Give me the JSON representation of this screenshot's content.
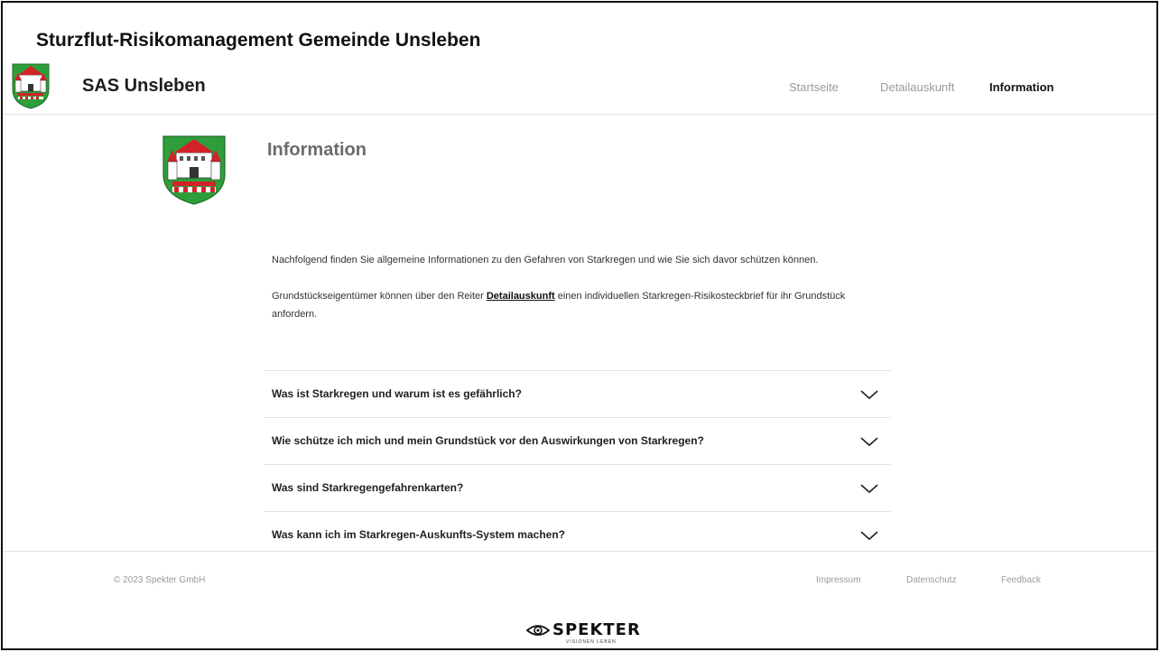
{
  "slide_title": "Sturzflut-Risikomanagement Gemeinde Unsleben",
  "header": {
    "brand": "SAS Unsleben",
    "nav": {
      "startseite": "Startseite",
      "detailauskunft": "Detailauskunft",
      "information": "Information"
    },
    "active_nav": "Information"
  },
  "main": {
    "heading": "Information",
    "para1": "Nachfolgend finden Sie allgemeine Informationen zu den Gefahren von Starkregen und wie Sie sich davor schützen können.",
    "para2_before": "Grundstückseigentümer können über den Reiter ",
    "para2_link": "Detailauskunft",
    "para2_after": " einen individuellen Starkregen-Risikosteckbrief für ihr Grundstück anfordern.",
    "faq": [
      {
        "label": "Was ist Starkregen und warum ist es gefährlich?"
      },
      {
        "label": "Wie schütze ich mich und mein Grundstück vor den Auswirkungen von Starkregen?"
      },
      {
        "label": "Was sind Starkregengefahrenkarten?"
      },
      {
        "label": "Was kann ich im Starkregen-Auskunfts-System machen?"
      }
    ]
  },
  "footer": {
    "copyright": "© 2023 Spekter GmbH",
    "impressum": "Impressum",
    "datenschutz": "Datenschutz",
    "feedback": "Feedback",
    "logo_text": "SPEKTER",
    "logo_tagline": "VISIONEN LEBEN"
  },
  "colors": {
    "crest_green": "#2e9e3a",
    "crest_red": "#d2232a",
    "nav_inactive": "#9a9a9a",
    "heading_grey": "#6b6b6b"
  },
  "icons": {
    "crest": "coat-of-arms-icon",
    "chevron": "chevron-down-icon",
    "logo": "eye-icon"
  }
}
